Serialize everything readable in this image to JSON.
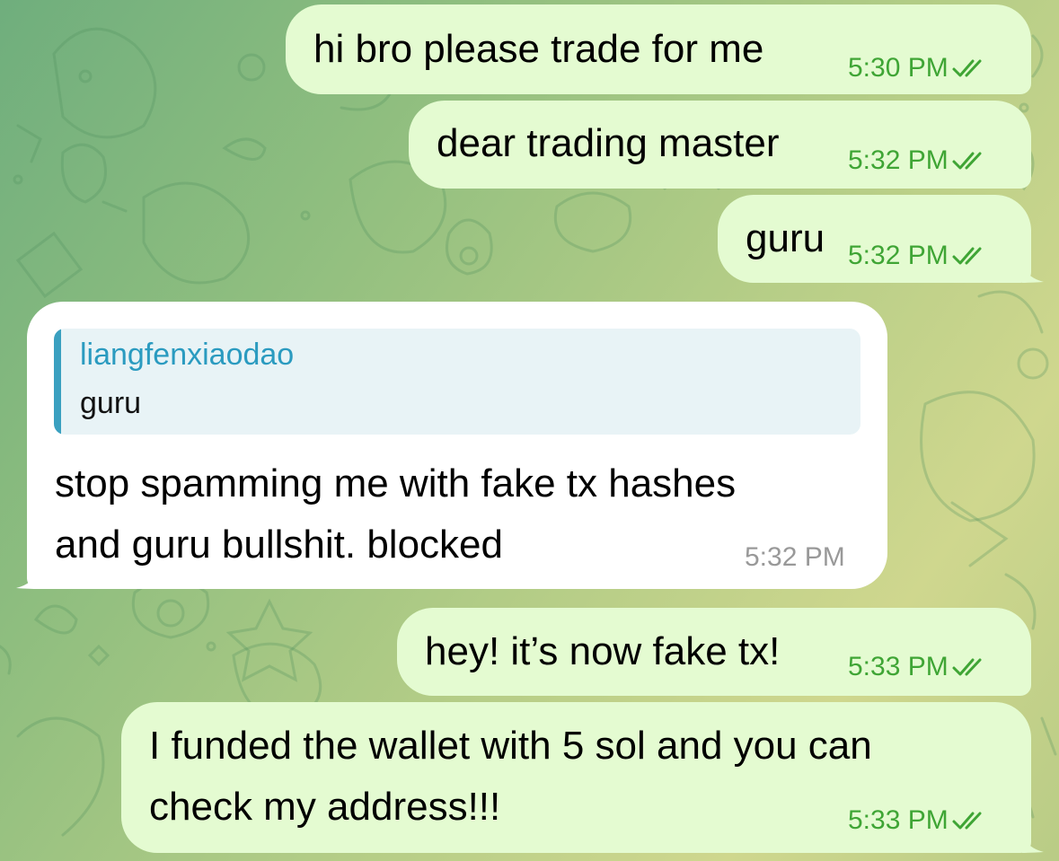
{
  "conversation": {
    "messages": [
      {
        "direction": "outgoing",
        "text": "hi bro please trade for me",
        "time": "5:30 PM",
        "status": "read"
      },
      {
        "direction": "outgoing",
        "text": "dear trading master",
        "time": "5:32 PM",
        "status": "read"
      },
      {
        "direction": "outgoing",
        "text": "guru",
        "time": "5:32 PM",
        "status": "read"
      },
      {
        "direction": "incoming",
        "reply_to": {
          "sender": "liangfenxiaodao",
          "text": "guru"
        },
        "lines": [
          "stop spamming me with fake tx hashes",
          "and guru bullshit. blocked"
        ],
        "time": "5:32 PM"
      },
      {
        "direction": "outgoing",
        "text": "hey! it’s now fake tx!",
        "time": "5:33 PM",
        "status": "read"
      },
      {
        "direction": "outgoing",
        "lines": [
          "I funded the wallet with 5 sol and you can",
          "check my address!!!"
        ],
        "time": "5:33 PM",
        "status": "read"
      }
    ]
  },
  "theme": {
    "outgoing_bubble": "#e4fbd1",
    "incoming_bubble": "#ffffff",
    "outgoing_meta": "#3fa535",
    "incoming_meta": "#999999",
    "reply_accent": "#2b9bc0",
    "read_icon": "double-check-icon"
  }
}
